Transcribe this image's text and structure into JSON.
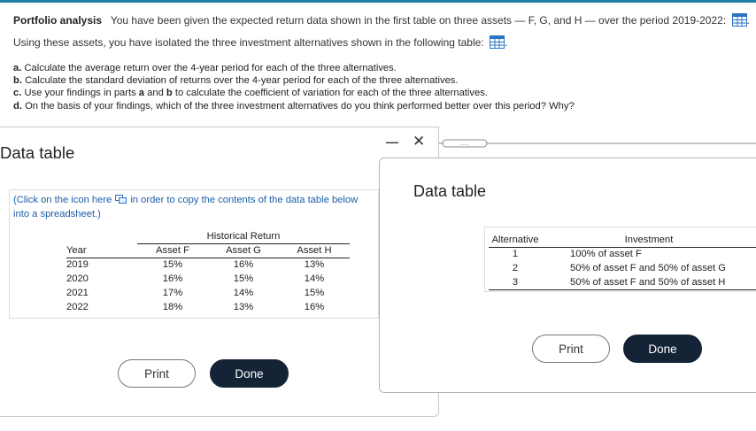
{
  "intro": {
    "heading": "Portfolio analysis",
    "text1": "You have been given the expected return data shown in the first table on three assets — F, G, and H — over the period 2019-2022:",
    "text2": "Using these assets, you have isolated the three investment alternatives shown in the following table:",
    "period_after_icon": "."
  },
  "questions": [
    {
      "letter": "a.",
      "text": "Calculate the average return over the 4-year period for each of the three alternatives."
    },
    {
      "letter": "b.",
      "text": "Calculate the standard deviation of returns over the 4-year period for each of the three alternatives."
    },
    {
      "letter": "c.",
      "pre": "Use your findings in parts",
      "a": "a",
      "and": "and",
      "b": "b",
      "post": "to calculate the coefficient of variation for each of the three alternatives."
    },
    {
      "letter": "d.",
      "text": "On the basis of your findings, which of the three investment alternatives do you think performed better over this period?  Why?"
    }
  ],
  "window1": {
    "title": "Data table",
    "minimize": "—",
    "close": "✕",
    "copy_note_pre": "(Click on the icon here",
    "copy_note_post": "in order to copy the contents of the data table below into a spreadsheet.)",
    "group_header": "Historical Return",
    "columns": [
      "Year",
      "Asset F",
      "Asset G",
      "Asset H"
    ],
    "rows": [
      [
        "2019",
        "15%",
        "16%",
        "13%"
      ],
      [
        "2020",
        "16%",
        "15%",
        "14%"
      ],
      [
        "2021",
        "17%",
        "14%",
        "15%"
      ],
      [
        "2022",
        "18%",
        "13%",
        "16%"
      ]
    ],
    "print_label": "Print",
    "done_label": "Done"
  },
  "window2": {
    "title": "Data table",
    "columns": [
      "Alternative",
      "Investment"
    ],
    "rows": [
      [
        "1",
        "100% of asset F"
      ],
      [
        "2",
        "50% of asset F and 50% of asset G"
      ],
      [
        "3",
        "50% of asset F and 50% of asset H"
      ]
    ],
    "print_label": "Print",
    "done_label": "Done"
  },
  "icons": {
    "table_icon": "table-icon",
    "copy_icon": "copy-icon"
  },
  "colors": {
    "accent_line": "#1f7fa7",
    "link_blue": "#1b5ea8",
    "icon_blue": "#2a73c5",
    "done_button": "#152337"
  }
}
